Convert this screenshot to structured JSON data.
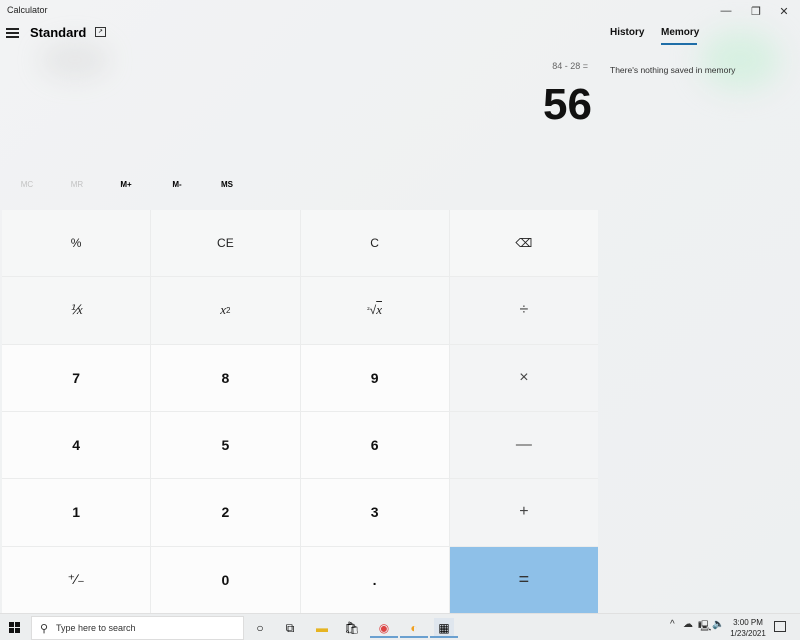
{
  "window": {
    "title": "Calculator",
    "controls": {
      "minimize": "—",
      "maximize": "❐",
      "close": "✕"
    }
  },
  "header": {
    "menu_icon": "hamburger-icon",
    "mode": "Standard",
    "keep_on_top_icon": "keep-on-top-icon"
  },
  "display": {
    "expression": "84 - 28 =",
    "result": "56"
  },
  "memory_bar": [
    {
      "label": "MC",
      "enabled": false
    },
    {
      "label": "MR",
      "enabled": false
    },
    {
      "label": "M+",
      "enabled": true
    },
    {
      "label": "M-",
      "enabled": true
    },
    {
      "label": "MS",
      "enabled": true
    }
  ],
  "keypad": {
    "percent": "%",
    "clear_entry": "CE",
    "clear": "C",
    "backspace": "⌫",
    "reciprocal": "⅟x",
    "square_base": "x",
    "square_exp": "2",
    "sqrt_index": "²",
    "sqrt_sign": "√",
    "sqrt_var": "x",
    "divide": "÷",
    "seven": "7",
    "eight": "8",
    "nine": "9",
    "multiply": "×",
    "four": "4",
    "five": "5",
    "six": "6",
    "subtract": "—",
    "one": "1",
    "two": "2",
    "three": "3",
    "add": "+",
    "negate": "⁺∕₋",
    "zero": "0",
    "decimal": ".",
    "equals": "="
  },
  "side_panel": {
    "tabs": [
      "History",
      "Memory"
    ],
    "active_tab": "Memory",
    "message": "There's nothing saved in memory",
    "accent_color": "#1f6ea8"
  },
  "taskbar": {
    "search_placeholder": "Type here to search",
    "apps": [
      "cortana-icon",
      "task-view-icon",
      "file-explorer-icon",
      "store-icon",
      "chrome-icon",
      "edge-icon",
      "calculator-icon"
    ],
    "time": "3:00 PM",
    "date": "1/23/2021"
  },
  "colors": {
    "equals_key": "#8ec0e8"
  }
}
